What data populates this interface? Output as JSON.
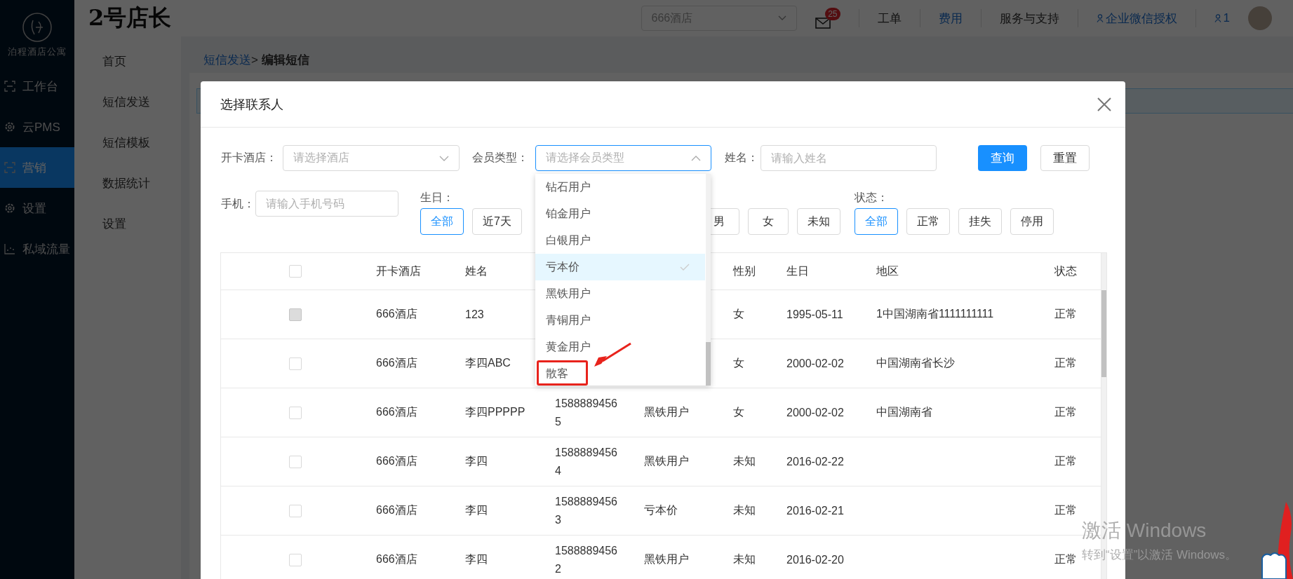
{
  "sidebar": {
    "brand": "泊程酒店公寓",
    "items": [
      {
        "label": "工作台",
        "selected": false
      },
      {
        "label": "云PMS",
        "selected": false
      },
      {
        "label": "营销",
        "selected": true
      },
      {
        "label": "设置",
        "selected": false
      },
      {
        "label": "私域流量",
        "selected": false
      }
    ]
  },
  "header": {
    "logo": "2号店长",
    "hotel_select": "666酒店",
    "mail_badge": "25",
    "links": [
      {
        "label": "工单",
        "kind": "text",
        "highlighted": false
      },
      {
        "label": "费用",
        "kind": "text",
        "highlighted": true
      },
      {
        "label": "服务与支持",
        "kind": "text",
        "highlighted": false
      },
      {
        "label": "企业微信授权",
        "kind": "account",
        "highlighted": true
      }
    ],
    "user": "1"
  },
  "submenu": {
    "items": [
      "首页",
      "短信发送",
      "短信模板",
      "数据统计",
      "设置"
    ]
  },
  "breadcrumb": {
    "link": "短信发送",
    "separator": ">",
    "current": "编辑短信"
  },
  "dialog": {
    "title": "选择联系人",
    "hotel": {
      "label": "开卡酒店：",
      "placeholder": "请选择酒店"
    },
    "member_type": {
      "label": "会员类型：",
      "placeholder": "请选择会员类型",
      "expanded": true,
      "options": [
        {
          "label": "钻石用户",
          "selected": false,
          "annotated": false
        },
        {
          "label": "铂金用户",
          "selected": false,
          "annotated": false
        },
        {
          "label": "白银用户",
          "selected": false,
          "annotated": false
        },
        {
          "label": "亏本价",
          "selected": true,
          "annotated": false
        },
        {
          "label": "黑铁用户",
          "selected": false,
          "annotated": false
        },
        {
          "label": "青铜用户",
          "selected": false,
          "annotated": false
        },
        {
          "label": "黄金用户",
          "selected": false,
          "annotated": false
        },
        {
          "label": "散客",
          "selected": false,
          "annotated": true
        }
      ]
    },
    "name": {
      "label": "姓名：",
      "placeholder": "请输入姓名"
    },
    "search_button": "查询",
    "reset_button": "重置",
    "phone": {
      "label": "手机：",
      "placeholder": "请输入手机号码"
    },
    "birthday": {
      "label": "生日：",
      "options": [
        {
          "label": "全部",
          "selected": true
        },
        {
          "label": "近7天",
          "selected": false
        }
      ]
    },
    "gender": {
      "options": [
        {
          "label": "男",
          "selected": false
        },
        {
          "label": "女",
          "selected": false
        },
        {
          "label": "未知",
          "selected": false
        }
      ]
    },
    "status": {
      "label": "状态：",
      "options": [
        {
          "label": "全部",
          "selected": true
        },
        {
          "label": "正常",
          "selected": false
        },
        {
          "label": "挂失",
          "selected": false
        },
        {
          "label": "停用",
          "selected": false
        }
      ]
    },
    "table": {
      "header": {
        "checked": false,
        "hotel": "开卡酒店",
        "name": "姓名",
        "gender": "性别",
        "birthday": "生日",
        "region": "地区",
        "status": "状态"
      },
      "rows": [
        {
          "checked": false,
          "disabled": true,
          "hotel": "666酒店",
          "name": "123",
          "gender": "女",
          "birthday": "1995-05-11",
          "region": "1中国湖南省1111111111",
          "status": "正常"
        },
        {
          "checked": false,
          "disabled": false,
          "hotel": "666酒店",
          "name": "李四ABC",
          "gender": "女",
          "birthday": "2000-02-02",
          "region": "中国湖南省长沙",
          "status": "正常"
        },
        {
          "checked": false,
          "disabled": false,
          "hotel": "666酒店",
          "name": "李四PPPPP",
          "phone": "15888894565",
          "member_type": "黑铁用户",
          "gender": "女",
          "birthday": "2000-02-02",
          "region": "中国湖南省",
          "status": "正常"
        },
        {
          "checked": false,
          "disabled": false,
          "hotel": "666酒店",
          "name": "李四",
          "phone": "15888894564",
          "member_type": "黑铁用户",
          "gender": "未知",
          "birthday": "2016-02-22",
          "status": "正常"
        },
        {
          "checked": false,
          "disabled": false,
          "hotel": "666酒店",
          "name": "李四",
          "phone": "15888894563",
          "member_type": "亏本价",
          "gender": "未知",
          "birthday": "2016-02-21",
          "status": "正常"
        },
        {
          "checked": false,
          "disabled": false,
          "hotel": "666酒店",
          "name": "李四",
          "phone": "15888894562",
          "member_type": "黑铁用户",
          "gender": "未知",
          "birthday": "2016-02-20",
          "status": "正常"
        }
      ]
    }
  },
  "os_overlay": {
    "title": "激活 Windows",
    "subtitle": "转到“设置”以激活 Windows。"
  }
}
